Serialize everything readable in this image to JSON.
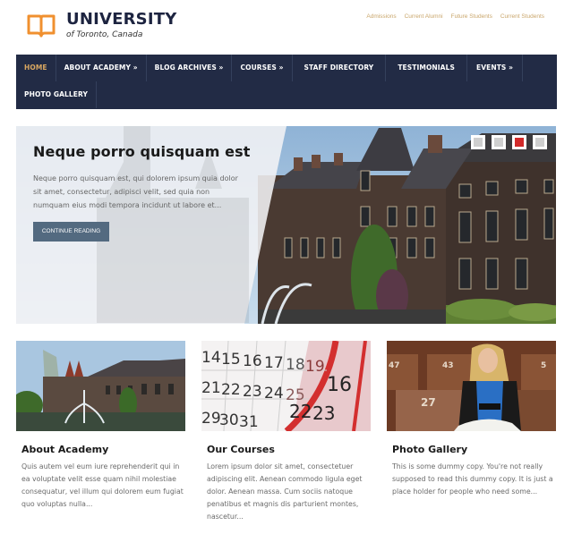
{
  "header": {
    "logo_icon": "open-book-icon",
    "title": "UNIVERSITY",
    "subtitle": "of Toronto, Canada",
    "brand_color": "#f0902f",
    "top_links": [
      "Admissions",
      "Current Alumni",
      "Future Students",
      "Current Students"
    ]
  },
  "nav": {
    "background": "#222b45",
    "active_color": "#d9a761",
    "items": [
      {
        "label": "HOME",
        "active": true
      },
      {
        "label": "ABOUT ACADEMY »"
      },
      {
        "label": "BLOG ARCHIVES »"
      },
      {
        "label": "COURSES »"
      },
      {
        "label": "STAFF DIRECTORY"
      },
      {
        "label": "TESTIMONIALS"
      },
      {
        "label": "EVENTS »"
      },
      {
        "label": "PHOTO GALLERY"
      }
    ]
  },
  "hero": {
    "title": "Neque porro quisquam est",
    "text": "Neque porro quisquam est, qui dolorem ipsum quia dolor sit amet, consectetur, adipisci velit, sed quia non numquam eius modi tempora incidunt ut labore et...",
    "button_label": "CONTINUE READING",
    "slides": 4,
    "active_slide": 3
  },
  "cards": [
    {
      "image": "parliament-building-fountain-photo",
      "title": "About Academy",
      "text": "Quis autem vel eum iure reprehenderit qui in ea voluptate velit esse quam nihil molestiae consequatur, vel illum qui dolorem eum fugiat quo voluptas nulla..."
    },
    {
      "image": "calendar-pages-photo",
      "title": "Our Courses",
      "text": "Lorem ipsum dolor sit amet, consectetuer adipiscing elit. Aenean commodo ligula eget dolor. Aenean massa. Cum sociis natoque penatibus et magnis dis parturient montes, nascetur..."
    },
    {
      "image": "student-reading-lecture-hall-photo",
      "title": "Photo Gallery",
      "text": "This is some dummy copy. You're not really supposed to read this dummy copy. It is just a place holder for people who need some..."
    }
  ]
}
